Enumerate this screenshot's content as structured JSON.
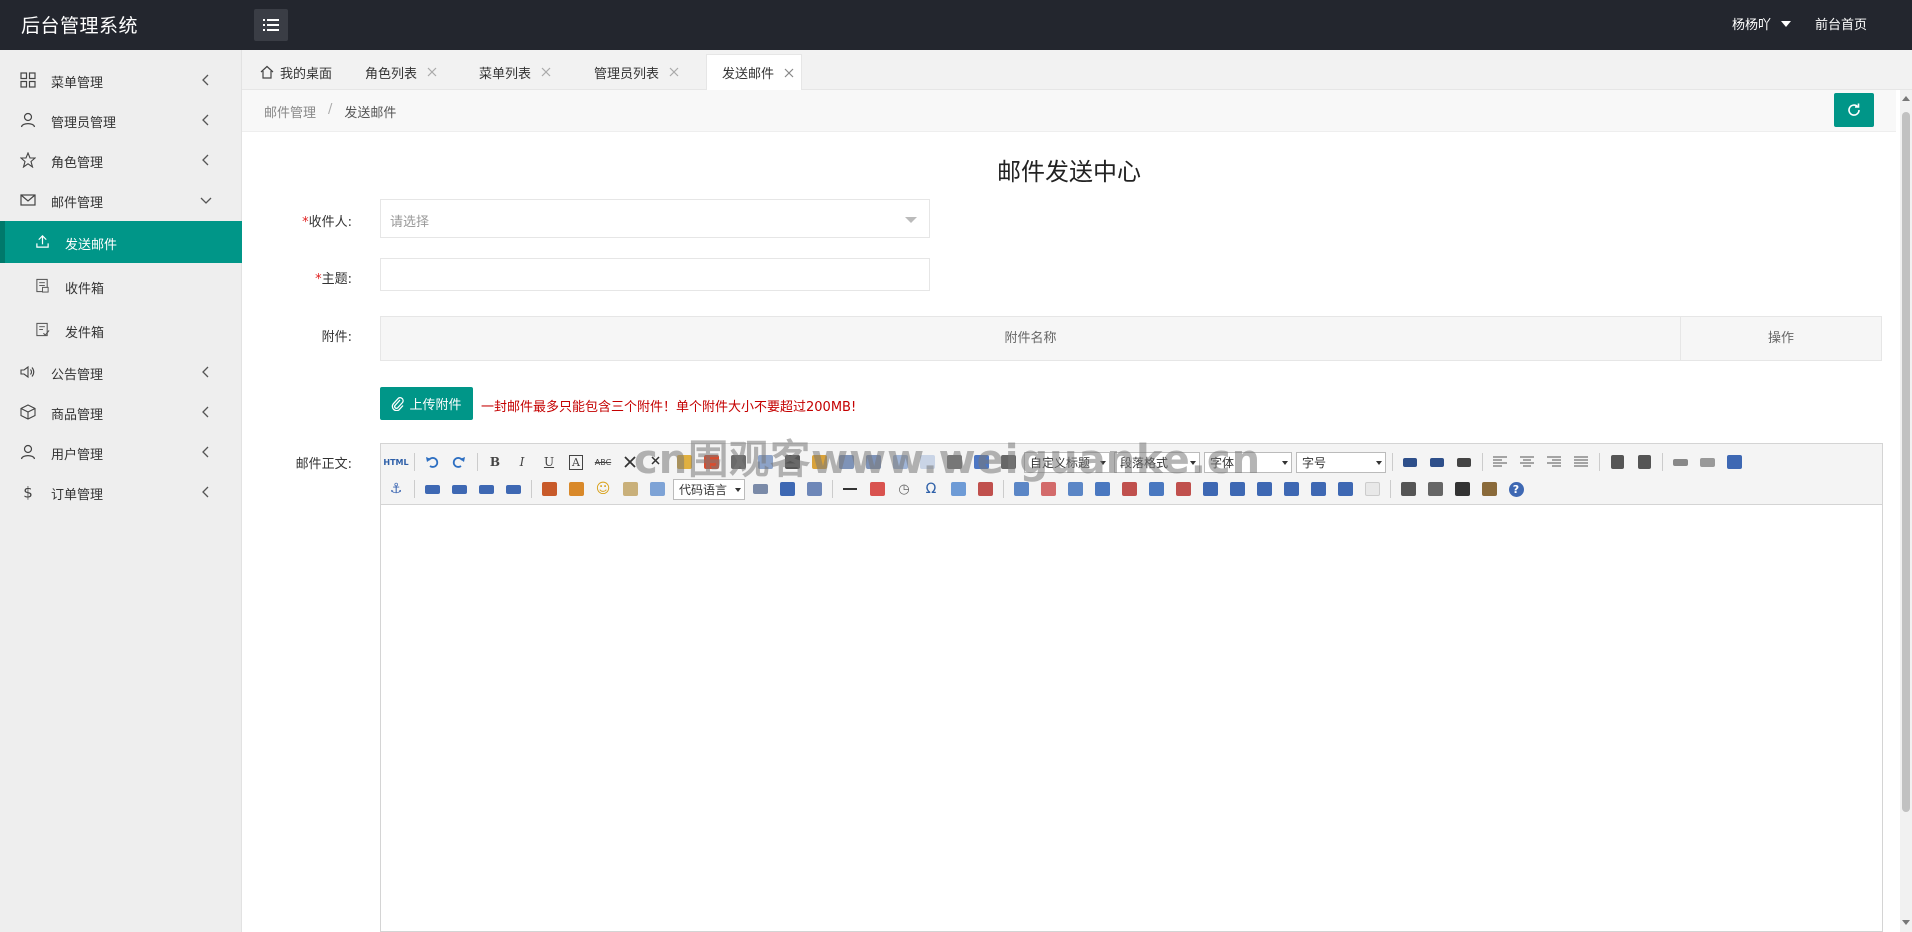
{
  "app": {
    "title": "后台管理系统"
  },
  "header": {
    "user": "杨杨吖",
    "home_link": "前台首页"
  },
  "sidebar": {
    "items": [
      {
        "label": "菜单管理"
      },
      {
        "label": "管理员管理"
      },
      {
        "label": "角色管理"
      },
      {
        "label": "邮件管理"
      },
      {
        "label": "发送邮件"
      },
      {
        "label": "收件箱"
      },
      {
        "label": "发件箱"
      },
      {
        "label": "公告管理"
      },
      {
        "label": "商品管理"
      },
      {
        "label": "用户管理"
      },
      {
        "label": "订单管理"
      }
    ]
  },
  "tabs": [
    {
      "label": "我的桌面"
    },
    {
      "label": "角色列表"
    },
    {
      "label": "菜单列表"
    },
    {
      "label": "管理员列表"
    },
    {
      "label": "发送邮件"
    }
  ],
  "breadcrumb": {
    "parent": "邮件管理",
    "sep": "/",
    "current": "发送邮件"
  },
  "page": {
    "title": "邮件发送中心"
  },
  "form": {
    "recipient_label": "收件人:",
    "recipient_placeholder": "请选择",
    "subject_label": "主题:",
    "attachment_label": "附件:",
    "attachment_col_name": "附件名称",
    "attachment_col_action": "操作",
    "upload_button": "上传附件",
    "upload_tip": "一封邮件最多只能包含三个附件！单个附件大小不要超过200MB!",
    "body_label": "邮件正文:",
    "required_mark": "*"
  },
  "editor": {
    "html_btn": "HTML",
    "bold": "B",
    "italic": "I",
    "underline": "U",
    "font_color": "A",
    "strike": "ABC",
    "paragraph_select": "段落格式",
    "custom_title_select": "自定义标题",
    "font_select": "字体",
    "size_select": "字号",
    "code_lang_select": "代码语言",
    "omega": "Ω"
  },
  "watermark": "cn围观客www.weiguanke.cn",
  "colors": {
    "header_bg": "#23262e",
    "accent": "#009688",
    "danger": "#c40000"
  }
}
